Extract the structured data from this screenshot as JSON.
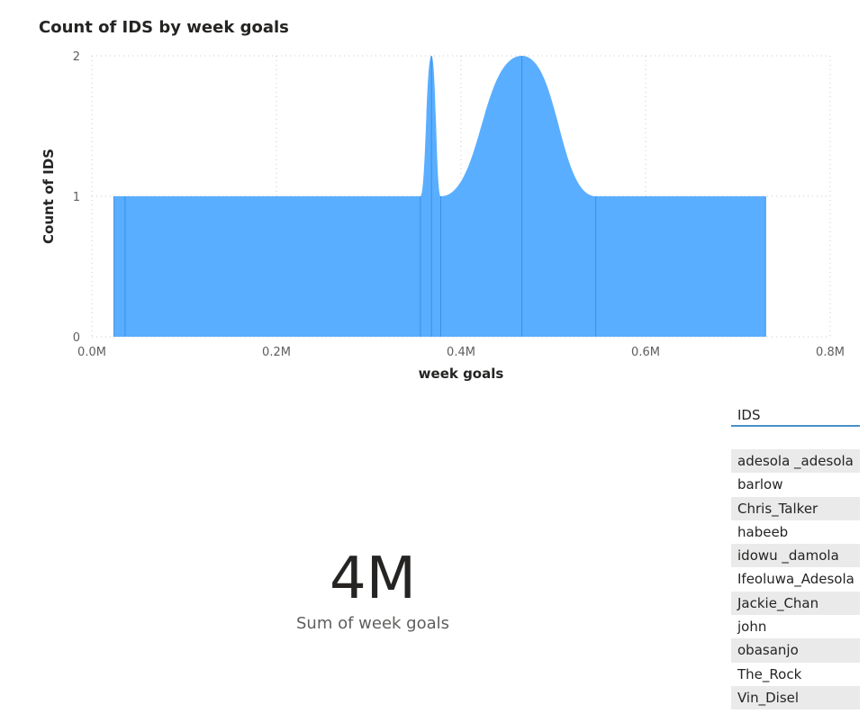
{
  "chart_data": {
    "type": "area",
    "title": "Count of IDS by week goals",
    "xlabel": "week goals",
    "ylabel": "Count of IDS",
    "xlim": [
      0,
      800000
    ],
    "ylim": [
      0,
      2
    ],
    "x_ticks": [
      "0.0M",
      "0.2M",
      "0.4M",
      "0.6M",
      "0.8M"
    ],
    "y_ticks": [
      "0",
      "1",
      "2"
    ],
    "grid": true,
    "color": "#5aaeff",
    "x": [
      24000,
      36000,
      356000,
      368000,
      378000,
      466000,
      546000,
      730000
    ],
    "values": [
      1,
      1,
      1,
      2,
      1,
      2,
      1,
      1
    ]
  },
  "card": {
    "value": "4M",
    "label": "Sum of week goals"
  },
  "slicer": {
    "header": "IDS",
    "items": [
      "adesola _adesola",
      "barlow",
      "Chris_Talker",
      "habeeb",
      "idowu _damola",
      "Ifeoluwa_Adesola",
      "Jackie_Chan",
      "john",
      "obasanjo",
      "The_Rock",
      "Vin_Disel"
    ]
  }
}
